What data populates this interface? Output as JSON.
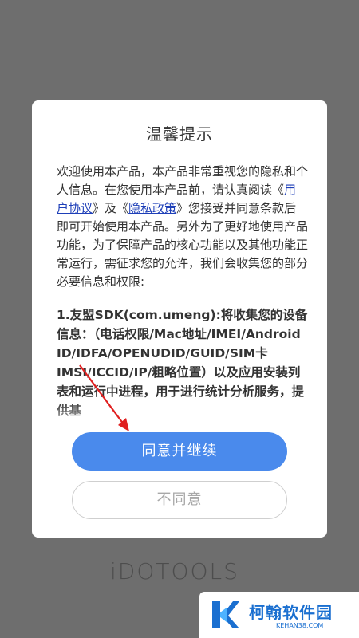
{
  "dialog": {
    "title": "温馨提示",
    "intro_1": "欢迎使用本产品，本产品非常重视您的隐私和个人信息。在您使用本产品前，请认真阅读《",
    "link_agreement": "用户协议",
    "intro_2": "》及《",
    "link_privacy": "隐私政策",
    "intro_3": "》您接受并同意条款后即可开始使用本产品。另外为了更好地使用产品功能，为了保障产品的核心功能以及其他功能正常运行，需征求您的允许，我们会收集您的部分必要信息和权限:",
    "section_1": "1.友盟SDK(com.umeng):将收集您的设备信息：（电话权限/Mac地址/IMEI/Android ID/IDFA/OPENUDID/GUID/SIM卡IMSI/ICCID/IP/粗略位置）以及应用安装列表和运行中进程，用于进行统计分析服务，提供基",
    "agree_label": "同意并继续",
    "disagree_label": "不同意"
  },
  "brand": {
    "name": "iDOTOOLS"
  },
  "watermark": {
    "name": "柯翰软件园",
    "url": "KEHAN38.COM"
  },
  "colors": {
    "overlay": "#6e6e6e",
    "agree_button": "#4a8aec",
    "link": "#1e3fb8",
    "arrow": "#e02020",
    "watermark": "#1a6fd0"
  }
}
